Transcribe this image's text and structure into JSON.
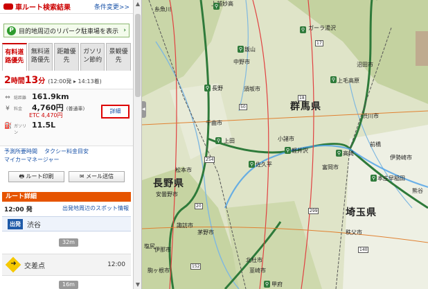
{
  "header": {
    "title": "車ルート検索結果",
    "change_link": "条件変更>>"
  },
  "parking": {
    "label": "目的地周辺のリパーク駐車場を表示",
    "icon": "P"
  },
  "tabs": [
    {
      "label": "有料道路優先",
      "active": true
    },
    {
      "label": "無料道路優先",
      "active": false
    },
    {
      "label": "距離優先",
      "active": false
    },
    {
      "label": "ガソリン節約",
      "active": false
    },
    {
      "label": "景観優先",
      "active": false
    }
  ],
  "summary": {
    "hours": "2",
    "hours_unit": "時間",
    "minutes": "13",
    "minutes_unit": "分",
    "times": "(12:00発 ▸ 14:13着)",
    "distance_label": "総距離",
    "distance": "161.9km",
    "fare_label": "料金",
    "fare": "4,760円",
    "fare_note": "(普通車)",
    "etc": "ETC 4,470円",
    "gas_label": "ガソリン",
    "gas": "11.5L",
    "detail_button": "詳細"
  },
  "links": {
    "forecast": "予測所要時間",
    "taxi": "タクシー料金目安",
    "mycar": "マイカーマネージャー"
  },
  "actions": {
    "print": "ルート印刷",
    "mail": "メール送信"
  },
  "route": {
    "title": "ルート詳細",
    "depart_time": "12:00 発",
    "spot_link": "出発地周辺のスポット情報",
    "start_badge": "出発",
    "start_name": "渋谷",
    "seg1": "32m",
    "turn_name": "交差点",
    "turn_time": "12:00",
    "seg2": "16m"
  },
  "map": {
    "prefectures": [
      "群馬県",
      "長野県",
      "埼玉県"
    ],
    "labels": [
      "糸魚川",
      "上越妙高",
      "ガーラ湯沢",
      "飯山",
      "上毛高原",
      "長野",
      "須坂市",
      "上田",
      "軽井沢",
      "佐久平",
      "高崎",
      "前橋",
      "本庄早稲田",
      "熊谷",
      "甲府",
      "塩尻",
      "松本市",
      "安曇野市",
      "渋川市",
      "沼田市",
      "中野市",
      "千曲市",
      "小諸市",
      "富岡市",
      "伊勢崎市",
      "秩父市",
      "茅野市",
      "韮崎市",
      "北杜市",
      "諏訪市",
      "伊那市",
      "駒ヶ根市"
    ],
    "road_numbers": [
      "18",
      "254",
      "20",
      "140",
      "17",
      "50",
      "299",
      "152"
    ]
  }
}
